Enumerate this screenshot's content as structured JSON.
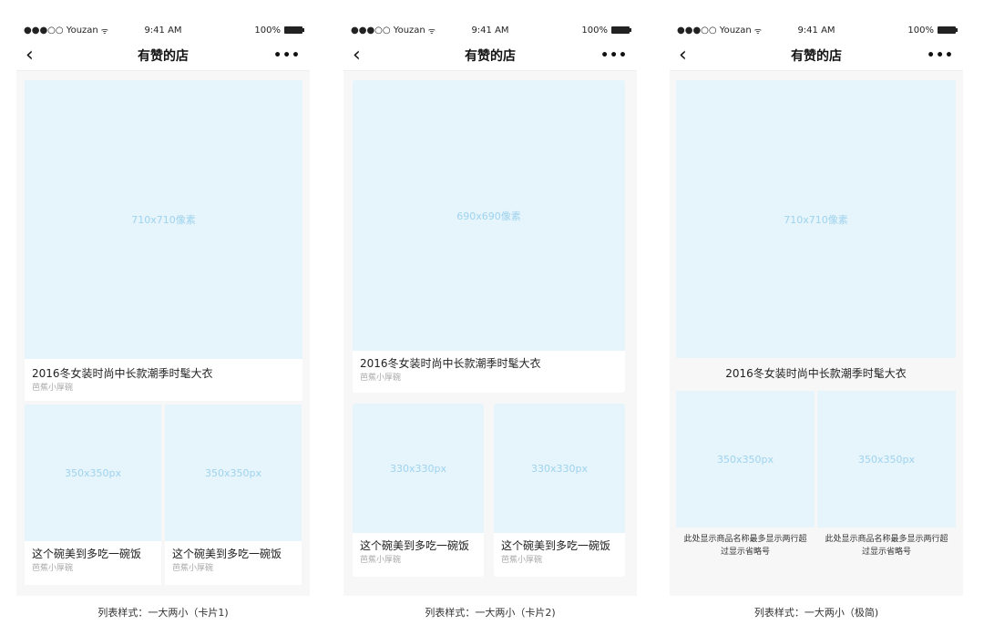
{
  "status": {
    "carrier": "●●●○○ Youzan",
    "wifi": "ᯤ",
    "time": "9:41 AM",
    "battery": "100%"
  },
  "nav": {
    "back": "‹",
    "title": "有赞的店",
    "more": "•••"
  },
  "phone1": {
    "big_placeholder": "710x710像素",
    "big_name": "2016冬女装时尚中长款潮季时髦大衣",
    "big_shop": "芭蕉小厚碗",
    "small": [
      {
        "placeholder": "350x350px",
        "name": "这个碗美到多吃一碗饭",
        "shop": "芭蕉小厚碗"
      },
      {
        "placeholder": "350x350px",
        "name": "这个碗美到多吃一碗饭",
        "shop": "芭蕉小厚碗"
      }
    ],
    "caption": "列表样式：一大两小（卡片1)"
  },
  "phone2": {
    "big_placeholder": "690x690像素",
    "big_name": "2016冬女装时尚中长款潮季时髦大衣",
    "big_shop": "芭蕉小厚碗",
    "small": [
      {
        "placeholder": "330x330px",
        "name": "这个碗美到多吃一碗饭",
        "shop": "芭蕉小厚碗"
      },
      {
        "placeholder": "330x330px",
        "name": "这个碗美到多吃一碗饭",
        "shop": "芭蕉小厚碗"
      }
    ],
    "caption": "列表样式：一大两小（卡片2)"
  },
  "phone3": {
    "big_placeholder": "710x710像素",
    "big_name": "2016冬女装时尚中长款潮季时髦大衣",
    "small": [
      {
        "placeholder": "350x350px",
        "name": "此处显示商品名称最多显示两行超过显示省略号"
      },
      {
        "placeholder": "350x350px",
        "name": "此处显示商品名称最多显示两行超过显示省略号"
      }
    ],
    "caption": "列表样式：一大两小（极简)"
  },
  "colors": {
    "placeholder_bg": "#e6f4fb",
    "placeholder_text": "#9fd3ee",
    "page_bg": "#f7f7f7"
  }
}
